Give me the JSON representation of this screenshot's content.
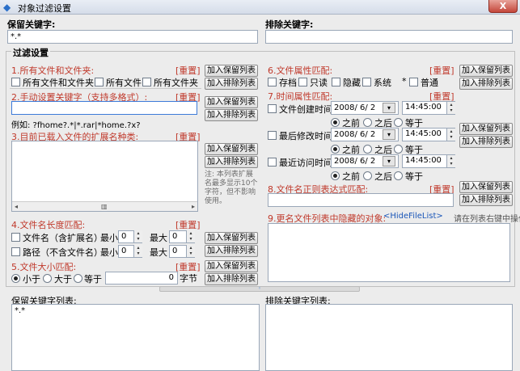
{
  "window": {
    "title": "对象过滤设置",
    "close": "X"
  },
  "keep_keywords": {
    "label": "保留关键字:",
    "value": "*.*"
  },
  "exclude_keywords": {
    "label": "排除关键字:",
    "value": ""
  },
  "filter_settings": {
    "label": "过滤设置"
  },
  "buttons": {
    "add_keep": "加入保留列表",
    "add_exclude": "加入排除列表",
    "reset": "[重置]"
  },
  "sec1": {
    "title": "1.所有文件和文件夹:",
    "opts": [
      "所有文件和文件夹",
      "所有文件",
      "所有文件夹"
    ]
  },
  "sec2": {
    "title": "2.手动设置关键字（支持多格式）:",
    "value": "",
    "example": "例如: ?fhome?.*|*.rar|*home.?x?"
  },
  "sec3": {
    "title": "3.目前已载入文件的扩展名种类:",
    "note": "注: 本列表扩展名最多显示10个字符，但不影响使用。"
  },
  "sec4": {
    "title": "4.文件名长度匹配:",
    "row1": "文件名（含扩展名）",
    "row2": "路径（不含文件名）",
    "min": "最小",
    "max": "最大",
    "val": "0"
  },
  "sec5": {
    "title": "5.文件大小匹配:",
    "opts": [
      "小于",
      "大于",
      "等于"
    ],
    "value": "0",
    "unit": "字节"
  },
  "sec6": {
    "title": "6.文件属性匹配:",
    "opts": [
      "存档",
      "只读",
      "隐藏",
      "系统",
      "普通"
    ],
    "star": "*"
  },
  "sec7": {
    "title": "7.时间属性匹配:",
    "rows": [
      {
        "label": "文件创建时间",
        "date": "2008/ 6/ 2",
        "time": "14:45:00"
      },
      {
        "label": "最后修改时间",
        "date": "2008/ 6/ 2",
        "time": "14:45:00"
      },
      {
        "label": "最近访问时间",
        "date": "2008/ 6/ 2",
        "time": "14:45:00"
      }
    ],
    "opts": [
      "之前",
      "之后",
      "等于"
    ]
  },
  "sec8": {
    "title": "8.文件名正则表达式匹配:",
    "value": ""
  },
  "sec9": {
    "title": "9.更名文件列表中隐藏的对象:",
    "tag": "<HideFileList>",
    "hint": "请在列表右键中操作"
  },
  "keep_list": {
    "label": "保留关键字列表:",
    "items": [
      "*.*"
    ]
  },
  "exclude_list": {
    "label": "排除关键字列表:",
    "items": []
  },
  "icons": {
    "app": "app-icon",
    "dropdown": "▾",
    "scroll_left": "◂",
    "scroll_right": "▸",
    "up": "▴",
    "down": "▾",
    "splitter": "◦"
  }
}
